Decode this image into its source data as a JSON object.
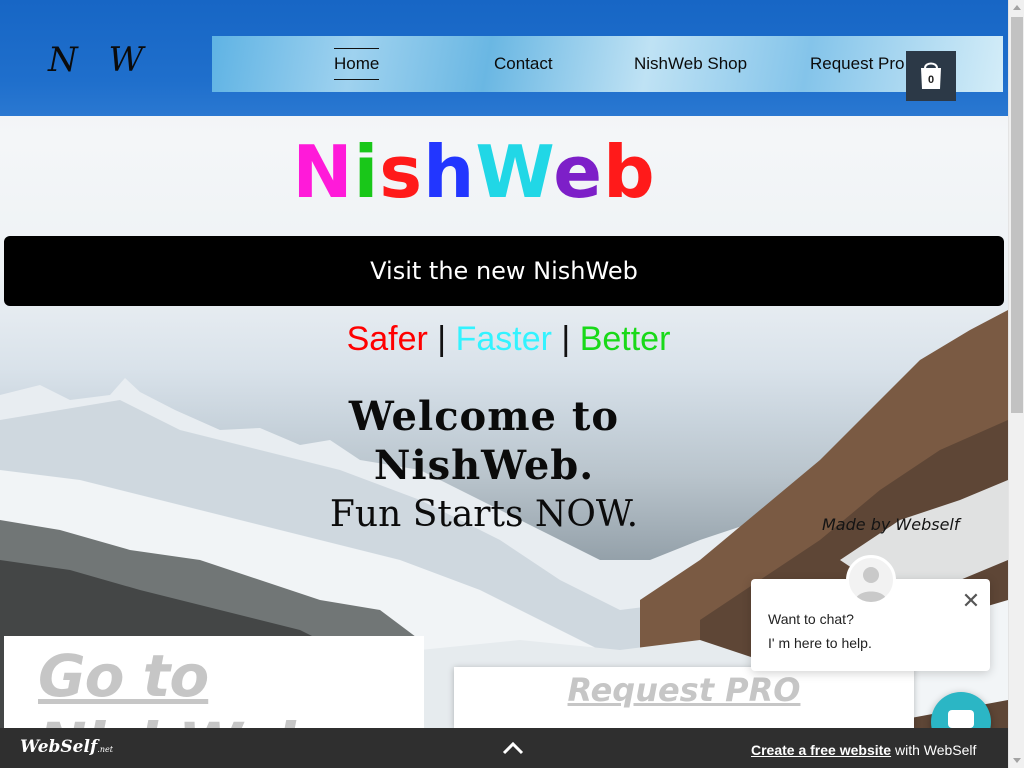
{
  "header": {
    "logo": "N W",
    "nav": [
      {
        "label": "Home",
        "active": true
      },
      {
        "label": "Contact",
        "active": false
      },
      {
        "label": "NishWeb Shop",
        "active": false
      },
      {
        "label": "Request Pro",
        "active": false
      }
    ],
    "cart_count": "0"
  },
  "hero": {
    "brand_letters": [
      {
        "char": "N",
        "color": "#ff1ad9"
      },
      {
        "char": "i",
        "color": "#19c719"
      },
      {
        "char": "s",
        "color": "#ff1a1a"
      },
      {
        "char": "h",
        "color": "#2236ff"
      },
      {
        "char": "W",
        "color": "#21d7e6"
      },
      {
        "char": "e",
        "color": "#7d1fc8"
      },
      {
        "char": "b",
        "color": "#ff1a1a"
      }
    ],
    "visit_button": "Visit the new NishWeb",
    "tagline": [
      {
        "text": "Safer",
        "color": "#ff0000"
      },
      {
        "text": " | ",
        "color": "#111111"
      },
      {
        "text": "Faster",
        "color": "#33f3ff"
      },
      {
        "text": " | ",
        "color": "#111111"
      },
      {
        "text": "Better",
        "color": "#19d919"
      }
    ],
    "welcome_line1": "Welcome to",
    "welcome_line2": "NishWeb.",
    "welcome_line3": "Fun Starts NOW.",
    "made_by": "Made by Webself"
  },
  "cards": {
    "go_to": "Go to NishWeb",
    "request_pro": "Request PRO"
  },
  "chat": {
    "line1": "Want to chat?",
    "line2": "I' m here to help.",
    "close_symbol": "✕"
  },
  "footer": {
    "logo": "WebSelf",
    "logo_suffix": ".net",
    "cta_link": "Create a free website",
    "cta_rest": " with WebSelf"
  },
  "colors": {
    "header_blue": "#1766c5",
    "cart_bg": "#2c3947",
    "visit_bg": "#000000",
    "chat_accent": "#2bb6c5",
    "footer_bg": "#2f2f2f"
  },
  "icons": {
    "cart": "shopping-bag-icon",
    "chat_avatar": "user-avatar-icon",
    "chat_launcher": "chat-bubble-icon",
    "footer_up": "chevron-up-icon"
  }
}
